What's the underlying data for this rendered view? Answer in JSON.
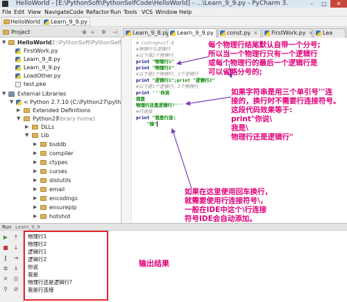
{
  "window": {
    "title": "HelloWorld - [E:\\PythonSoft\\PythonSelfCode\\HelloWorld] - ...\\Learn_9_9.py - PyCharm 3.",
    "min": "–",
    "max": "□",
    "close": "✕"
  },
  "menu": [
    "File",
    "Edit",
    "View",
    "Navigate",
    "Code",
    "Refactor",
    "Run",
    "Tools",
    "VCS",
    "Window",
    "Help"
  ],
  "breadcrumb": [
    "HelloWorld",
    "Learn_9_9.py"
  ],
  "project": {
    "title": "Project",
    "root": {
      "name": "HelloWorld",
      "path": "(E:\\PythonSoft\\PythonSelfCode\\HelloW"
    },
    "files": [
      "FirstWork.py",
      "Learn_9_8.py",
      "Learn_9_9.py",
      "LoadOther.py",
      "test.pke"
    ],
    "external": "External Libraries",
    "python": "< Python 2.7.10 (C:\\Python27\\python.exe",
    "ext_def": "Extended Definitions",
    "python27": "Python27",
    "python27_hint": "(library home)",
    "dlls": "DLLs",
    "lib": "Lib",
    "lib_items": [
      "bsddb",
      "compiler",
      "ctypes",
      "curses",
      "distutils",
      "email",
      "encodings",
      "ensurepip",
      "hotshot"
    ]
  },
  "tabs": [
    "Learn_9_8.py",
    "Learn_9_9.py",
    "const.py",
    "FirstWork.py",
    "Lea"
  ],
  "code": [
    {
      "t": "comment",
      "s": "# coding=utf-8"
    },
    {
      "t": "comment",
      "s": "#物理行与逻辑行"
    },
    {
      "t": "comment",
      "s": "#以下是2个物理行"
    },
    {
      "t": "print",
      "k": "print ",
      "s": "\"物理行1\""
    },
    {
      "t": "print",
      "k": "print ",
      "s": "\"物理行2\""
    },
    {
      "t": "comment",
      "s": "#以下是1个物理行，2个逻辑行"
    },
    {
      "t": "print",
      "k": "print ",
      "s": "\"逻辑行1\";print \"逻辑行2\""
    },
    {
      "t": "comment",
      "s": "#以下是1个逻辑行，2个物理行"
    },
    {
      "t": "print",
      "k": "print ",
      "s": "'''你说"
    },
    {
      "t": "str",
      "s": "我是"
    },
    {
      "t": "str",
      "s": "物理行还是逻辑行?'''"
    },
    {
      "t": "comment",
      "s": "#行连接"
    },
    {
      "t": "print",
      "k": "print ",
      "s": "\"我是行连\\"
    },
    {
      "t": "str",
      "s": "    \"接\""
    }
  ],
  "annotations": {
    "a1": "每个物理行结尾默认自带一个分号;\n所以当一个物理行只有一个逻辑行\n或每个物理行的最后一个逻辑行是\n可以省略分号的;",
    "a2": "如果字符串是用三个单引号'''连\n接的，换行时不需要行连接符号。\n这段代码效果等于:\nprint\"你说\\\n我是\\\n物理行还是逻辑行\"",
    "a3": "如果在这里使用回车换行，\n就需要使用行连接符号\\，\n一般在IDE中这个\\行连接\n符号IDE会自动添加。",
    "output_label": "输出结果"
  },
  "run": {
    "tab": "Run",
    "config": "Learn_9_9",
    "output": [
      "物理行1",
      "物理行2",
      "逻辑行1",
      "逻辑行2",
      "你说",
      "我是",
      "物理行还是逻辑行?",
      "我是行连接"
    ]
  },
  "colors": {
    "annotation": "#e0007a",
    "box": "#e0242a",
    "arrow": "#7a3fb8"
  }
}
